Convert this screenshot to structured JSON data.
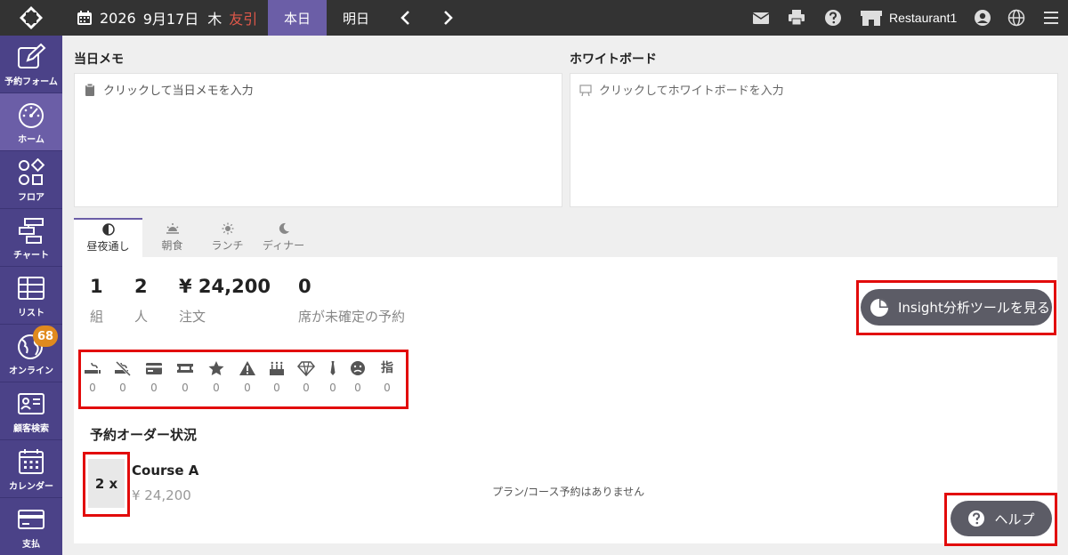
{
  "topbar": {
    "year": "2026",
    "date": "9月17日",
    "day_of_week": "木",
    "rokuyo": "友引",
    "today_tab": "本日",
    "tomorrow_tab": "明日",
    "restaurant_name": "Restaurant1",
    "rokuyo_color": "#e0584a"
  },
  "sidebar": {
    "items": [
      {
        "label": "予約フォーム",
        "icon": "edit-icon"
      },
      {
        "label": "ホーム",
        "icon": "dashboard-icon"
      },
      {
        "label": "フロア",
        "icon": "shapes-icon"
      },
      {
        "label": "チャート",
        "icon": "chart-icon"
      },
      {
        "label": "リスト",
        "icon": "table-icon"
      },
      {
        "label": "オンライン",
        "icon": "globe-icon",
        "badge": "68"
      },
      {
        "label": "顧客検索",
        "icon": "contact-card-icon"
      },
      {
        "label": "カレンダー",
        "icon": "calendar-icon"
      },
      {
        "label": "支払",
        "icon": "credit-card-icon"
      }
    ],
    "active_color": "#6b5ea7",
    "bg_color": "#4b4288"
  },
  "memo": {
    "daily_title": "当日メモ",
    "daily_placeholder": "クリックして当日メモを入力",
    "whiteboard_title": "ホワイトボード",
    "whiteboard_placeholder": "クリックしてホワイトボードを入力"
  },
  "meal_tabs": [
    {
      "label": "昼夜通し",
      "icon": "half-circle-icon"
    },
    {
      "label": "朝食",
      "icon": "sunrise-icon"
    },
    {
      "label": "ランチ",
      "icon": "sun-icon"
    },
    {
      "label": "ディナー",
      "icon": "moon-icon"
    }
  ],
  "stats": [
    {
      "value": "1",
      "label": "組"
    },
    {
      "value": "2",
      "label": "人"
    },
    {
      "value": "¥ 24,200",
      "label": "注文"
    },
    {
      "value": "0",
      "label": "席が未確定の予約"
    }
  ],
  "insight_button": "Insight分析ツールを見る",
  "tags": [
    {
      "icon": "smoking-icon",
      "count": "0"
    },
    {
      "icon": "no-smoking-icon",
      "count": "0"
    },
    {
      "icon": "credit-card-icon",
      "count": "0"
    },
    {
      "icon": "ticket-icon",
      "count": "0"
    },
    {
      "icon": "star-icon",
      "count": "0"
    },
    {
      "icon": "warning-icon",
      "count": "0"
    },
    {
      "icon": "birthday-cake-icon",
      "count": "0"
    },
    {
      "icon": "diamond-icon",
      "count": "0"
    },
    {
      "icon": "necktie-icon",
      "count": "0"
    },
    {
      "icon": "frown-face-icon",
      "count": "0"
    },
    {
      "text": "指",
      "count": "0"
    }
  ],
  "order": {
    "title": "予約オーダー状況",
    "quantity": "2 x",
    "course_name": "Course A",
    "course_price": "¥ 24,200",
    "no_plan_message": "プラン/コース予約はありません"
  },
  "help_button": "ヘルプ",
  "highlight_color": "#e20b0b"
}
